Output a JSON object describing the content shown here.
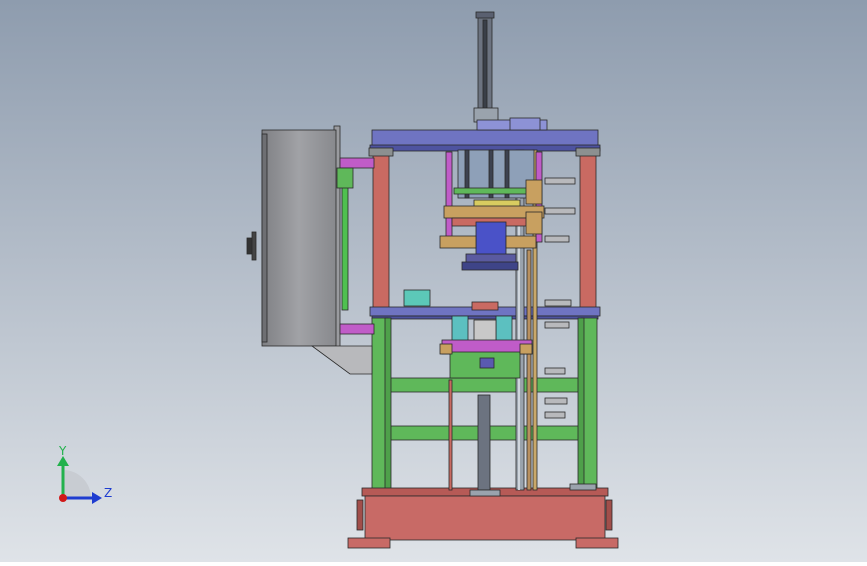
{
  "triad": {
    "y_label": "Y",
    "z_label": "Z",
    "colors": {
      "y": "#22b14c",
      "z": "#1e3cd0",
      "origin": "#d01818"
    }
  },
  "colors": {
    "bg_top": "#8c9aac",
    "bg_bottom": "#d8dde4",
    "frame_green": "#5fb85a",
    "frame_red": "#c96a62",
    "plate_blue": "#6f74c2",
    "cabinet_gray": "#8f9094",
    "base_red": "#c86a66",
    "rod_gray": "#9aa3ad",
    "magenta": "#c05cc8",
    "tan": "#c8a060"
  }
}
